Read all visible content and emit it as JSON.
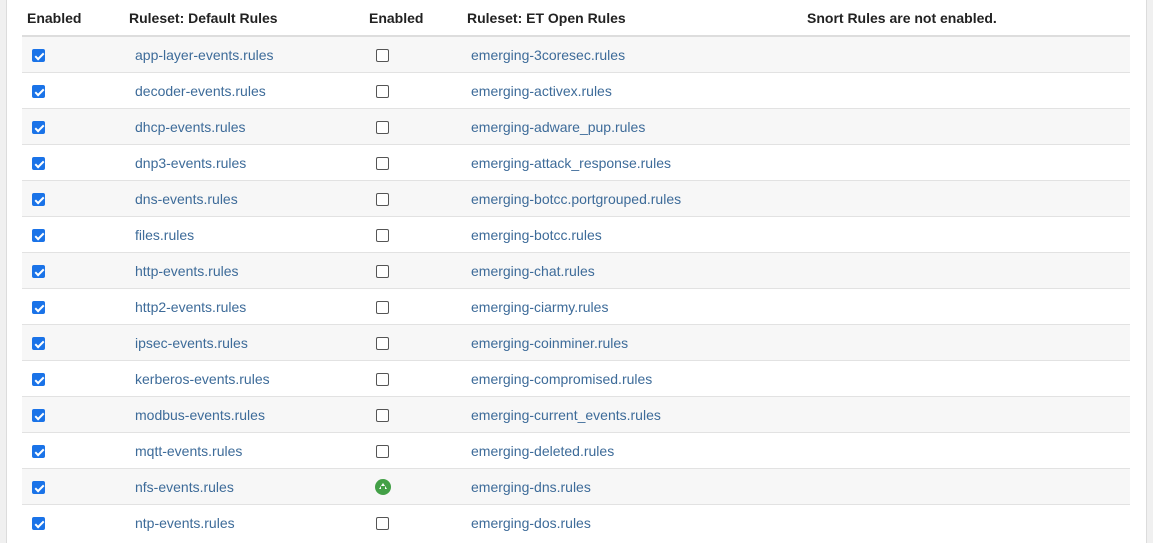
{
  "headers": {
    "enabled_left": "Enabled",
    "ruleset_default": "Ruleset: Default Rules",
    "enabled_right": "Enabled",
    "ruleset_et": "Ruleset: ET Open Rules",
    "snort_status": "Snort Rules are not enabled."
  },
  "rows": [
    {
      "default_rule": "app-layer-events.rules",
      "default_enabled": true,
      "et_rule": "emerging-3coresec.rules",
      "et_state": "unchecked"
    },
    {
      "default_rule": "decoder-events.rules",
      "default_enabled": true,
      "et_rule": "emerging-activex.rules",
      "et_state": "unchecked"
    },
    {
      "default_rule": "dhcp-events.rules",
      "default_enabled": true,
      "et_rule": "emerging-adware_pup.rules",
      "et_state": "unchecked"
    },
    {
      "default_rule": "dnp3-events.rules",
      "default_enabled": true,
      "et_rule": "emerging-attack_response.rules",
      "et_state": "unchecked"
    },
    {
      "default_rule": "dns-events.rules",
      "default_enabled": true,
      "et_rule": "emerging-botcc.portgrouped.rules",
      "et_state": "unchecked"
    },
    {
      "default_rule": "files.rules",
      "default_enabled": true,
      "et_rule": "emerging-botcc.rules",
      "et_state": "unchecked"
    },
    {
      "default_rule": "http-events.rules",
      "default_enabled": true,
      "et_rule": "emerging-chat.rules",
      "et_state": "unchecked"
    },
    {
      "default_rule": "http2-events.rules",
      "default_enabled": true,
      "et_rule": "emerging-ciarmy.rules",
      "et_state": "unchecked"
    },
    {
      "default_rule": "ipsec-events.rules",
      "default_enabled": true,
      "et_rule": "emerging-coinminer.rules",
      "et_state": "unchecked"
    },
    {
      "default_rule": "kerberos-events.rules",
      "default_enabled": true,
      "et_rule": "emerging-compromised.rules",
      "et_state": "unchecked"
    },
    {
      "default_rule": "modbus-events.rules",
      "default_enabled": true,
      "et_rule": "emerging-current_events.rules",
      "et_state": "unchecked"
    },
    {
      "default_rule": "mqtt-events.rules",
      "default_enabled": true,
      "et_rule": "emerging-deleted.rules",
      "et_state": "unchecked"
    },
    {
      "default_rule": "nfs-events.rules",
      "default_enabled": true,
      "et_rule": "emerging-dns.rules",
      "et_state": "scroll-top-icon"
    },
    {
      "default_rule": "ntp-events.rules",
      "default_enabled": true,
      "et_rule": "emerging-dos.rules",
      "et_state": "unchecked"
    }
  ],
  "colors": {
    "link": "#3d6b99",
    "checkbox_checked": "#1a73e8",
    "scroll_top_badge": "#43a047"
  }
}
